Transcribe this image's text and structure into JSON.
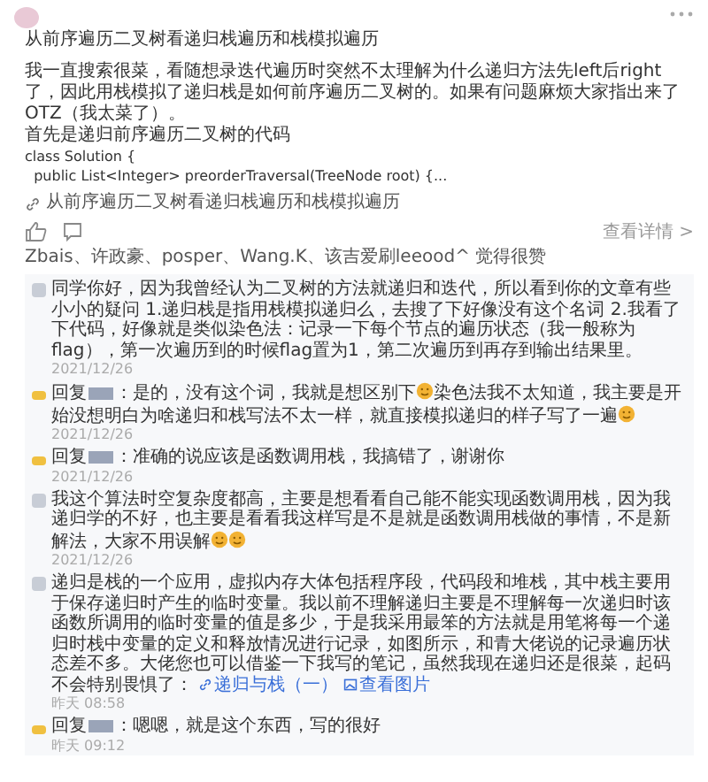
{
  "post": {
    "title": "从前序遍历二叉树看递归栈遍历和栈模拟遍历",
    "paragraphs": [
      "我一直搜索很菜，看随想录迭代遍历时突然不太理解为什么递归方法先left后right了，因此用栈模拟了递归栈是如何前序遍历二叉树的。如果有问题麻烦大家指出来了OTZ（我太菜了）。",
      "首先是递归前序遍历二叉树的代码"
    ],
    "code": [
      "class Solution {",
      "  public List<Integer> preorderTraversal(TreeNode root) {..."
    ],
    "link": "从前序遍历二叉树看递归栈遍历和栈模拟遍历",
    "details": "查看详情 >",
    "likers": "Zbais、许政豪、posper、Wang.K、该吉爱刷leeood^ 觉得很赞"
  },
  "comments": [
    {
      "kind": "comment",
      "segments": [
        {
          "kind": "text",
          "text": "同学你好，因为我曾经认为二叉树的方法就递归和迭代，所以看到你的文章有些小小的疑问 1.递归栈是指用栈模拟递归么，去搜了下好像没有这个名词 2.我看了下代码，好像就是类似染色法：记录一下每个节点的遍历状态（我一般称为flag），第一次遍历到的时候flag置为1，第二次遍历到再存到输出结果里。"
        }
      ],
      "time": "2021/12/26"
    },
    {
      "kind": "reply",
      "segments": [
        {
          "kind": "text",
          "text": "回复"
        },
        {
          "kind": "name"
        },
        {
          "kind": "text",
          "text": "：是的，没有这个词，我就是想区别下"
        },
        {
          "kind": "emoji"
        },
        {
          "kind": "text",
          "text": "染色法我不太知道，我主要是开始没想明白为啥递归和栈写法不太一样，就直接模拟递归的样子写了一遍"
        },
        {
          "kind": "emoji"
        }
      ],
      "time": "2021/12/26"
    },
    {
      "kind": "reply",
      "segments": [
        {
          "kind": "text",
          "text": "回复"
        },
        {
          "kind": "name"
        },
        {
          "kind": "text",
          "text": "：准确的说应该是函数调用栈，我搞错了，谢谢你"
        }
      ],
      "time": "2021/12/26"
    },
    {
      "kind": "comment",
      "segments": [
        {
          "kind": "text",
          "text": "我这个算法时空复杂度都高，主要是想看看自己能不能实现函数调用栈，因为我递归学的不好，也主要是看看我这样写是不是就是函数调用栈做的事情，不是新解法，大家不用误解"
        },
        {
          "kind": "emoji"
        },
        {
          "kind": "emoji"
        }
      ],
      "time": "2021/12/26"
    },
    {
      "kind": "comment",
      "segments": [
        {
          "kind": "text",
          "text": "递归是栈的一个应用，虚拟内存大体包括程序段，代码段和堆栈，其中栈主要用于保存递归时产生的临时变量。我以前不理解递归主要是不理解每一次递归时该函数所调用的临时变量的值是多少，于是我采用最笨的方法就是用笔将每一个递归时栈中变量的定义和释放情况进行记录，如图所示，和青大佬说的记录遍历状态差不多。大佬您也可以借鉴一下我写的笔记，虽然我现在递归还是很菜，起码不会特别畏惧了："
        },
        {
          "kind": "link",
          "text": "递归与栈（一）"
        },
        {
          "kind": "image",
          "text": "查看图片"
        }
      ],
      "time": "昨天 08:58"
    },
    {
      "kind": "reply",
      "segments": [
        {
          "kind": "text",
          "text": "回复"
        },
        {
          "kind": "name"
        },
        {
          "kind": "text",
          "text": "：嗯嗯，就是这个东西，写的很好"
        }
      ],
      "time": "昨天 09:12"
    }
  ]
}
